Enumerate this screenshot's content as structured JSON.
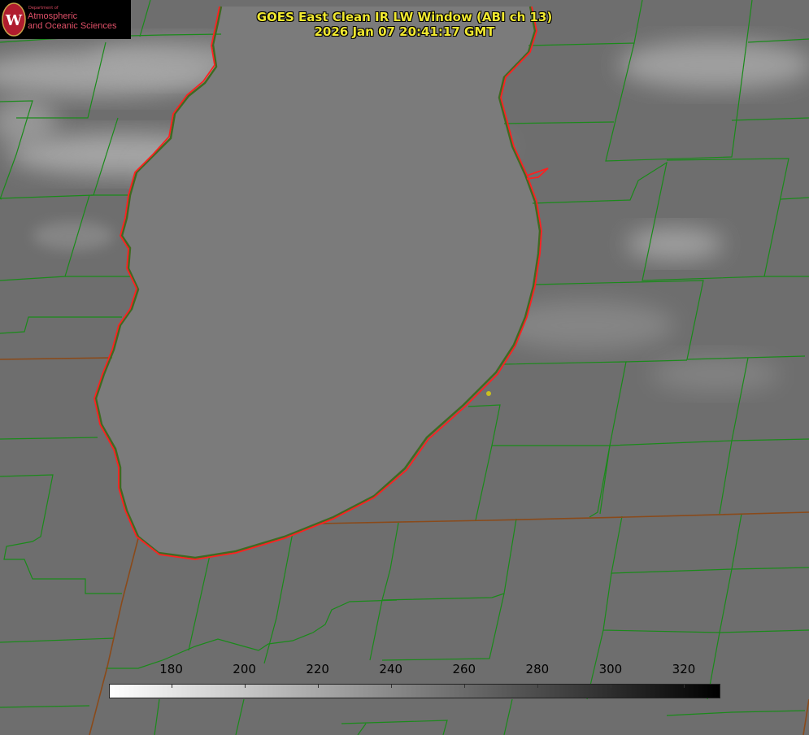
{
  "title": {
    "line1": "GOES East Clean IR LW Window (ABI ch 13)",
    "line2": "2026 Jan 07 20:41:17 GMT"
  },
  "logo": {
    "dept": "Department of",
    "line1": "Atmospheric",
    "line2": "and Oceanic Sciences",
    "seal_letter": "W",
    "seal_color": "#b01c2e",
    "text_color": "#e05068"
  },
  "colorbar": {
    "ticks": [
      "180",
      "200",
      "220",
      "240",
      "260",
      "280",
      "300",
      "320"
    ],
    "tick_values": [
      180,
      200,
      220,
      240,
      260,
      280,
      300,
      320
    ],
    "range": [
      163,
      330
    ],
    "gradient": [
      "#ffffff",
      "#000000"
    ]
  },
  "colors": {
    "background": "#6f6f6f",
    "lake": "#7c7c7c",
    "county_lines": "#1a8a1a",
    "state_lines": "#8a4a1a",
    "coastline": "#ff2020",
    "title": "#f0e830",
    "site_marker": "#c9c020"
  }
}
